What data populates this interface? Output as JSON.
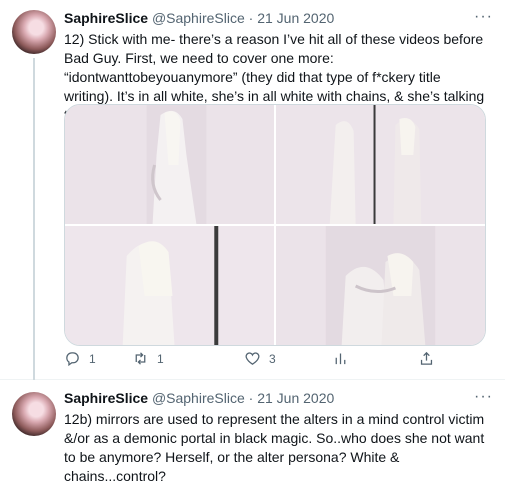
{
  "tweets": [
    {
      "name": "SaphireSlice",
      "handle": "@SaphireSlice",
      "separator": "·",
      "date": "21 Jun 2020",
      "text": "12) Stick with me- there’s a reason I’ve hit all of these videos before Bad Guy. First, we need to cover one more: “idontwanttobeyouanymore” (they did that type of f*ckery title writing). It’s in all white, she’s in all white with chains, & she’s talking to herself in a mirror..",
      "media_count": 4,
      "actions": {
        "replies": "1",
        "retweets": "1",
        "likes": "3"
      },
      "icons": [
        "reply-icon",
        "retweet-icon",
        "like-icon",
        "analytics-icon",
        "share-icon"
      ]
    },
    {
      "name": "SaphireSlice",
      "handle": "@SaphireSlice",
      "separator": "·",
      "date": "21 Jun 2020",
      "text": "12b) mirrors are used to represent the alters in a mind control victim &/or as a demonic portal in black magic. So..who does she not want to be anymore? Herself, or the alter persona? White & chains...control?"
    }
  ],
  "colors": {
    "text": "#0f1419",
    "secondary": "#536471",
    "border": "#cfd9de",
    "background": "#ffffff"
  }
}
